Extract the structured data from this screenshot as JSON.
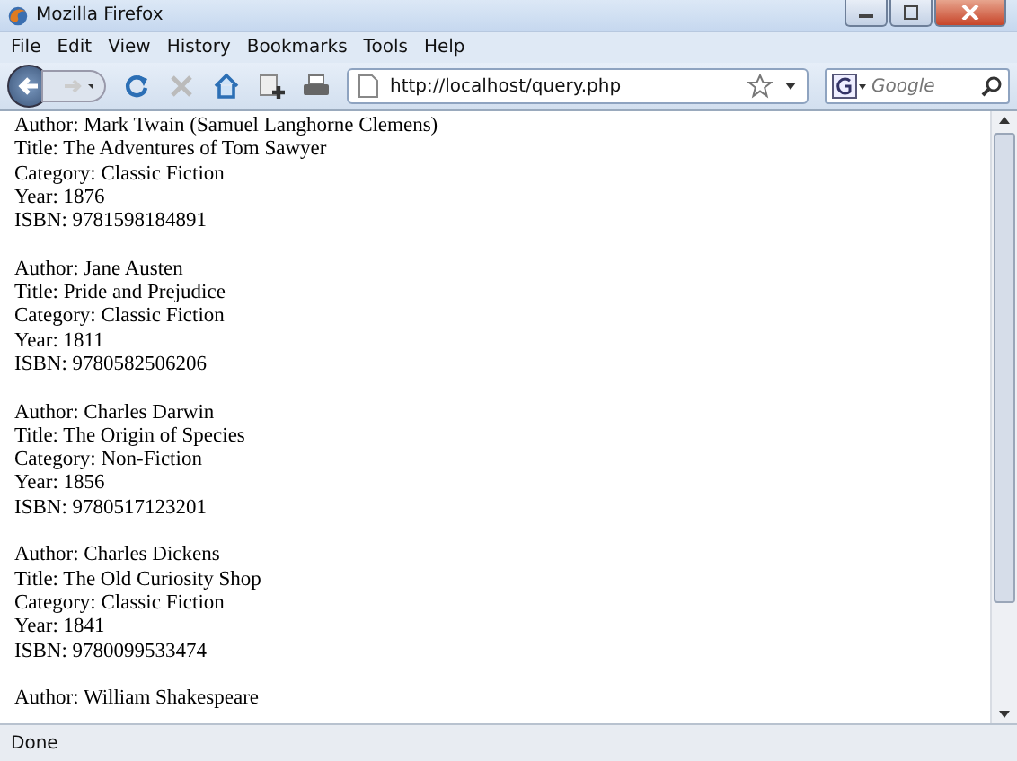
{
  "window": {
    "title": "Mozilla Firefox"
  },
  "menu": [
    "File",
    "Edit",
    "View",
    "History",
    "Bookmarks",
    "Tools",
    "Help"
  ],
  "address_bar": {
    "value": "http://localhost/query.php"
  },
  "search": {
    "placeholder": "Google"
  },
  "records": [
    [
      "Author: Mark Twain (Samuel Langhorne Clemens)",
      "Title: The Adventures of Tom Sawyer",
      "Category: Classic Fiction",
      "Year: 1876",
      "ISBN: 9781598184891"
    ],
    [
      "Author: Jane Austen",
      "Title: Pride and Prejudice",
      "Category: Classic Fiction",
      "Year: 1811",
      "ISBN: 9780582506206"
    ],
    [
      "Author: Charles Darwin",
      "Title: The Origin of Species",
      "Category: Non-Fiction",
      "Year: 1856",
      "ISBN: 9780517123201"
    ],
    [
      "Author: Charles Dickens",
      "Title: The Old Curiosity Shop",
      "Category: Classic Fiction",
      "Year: 1841",
      "ISBN: 9780099533474"
    ],
    [
      "Author: William Shakespeare"
    ]
  ],
  "status_bar": "Done"
}
